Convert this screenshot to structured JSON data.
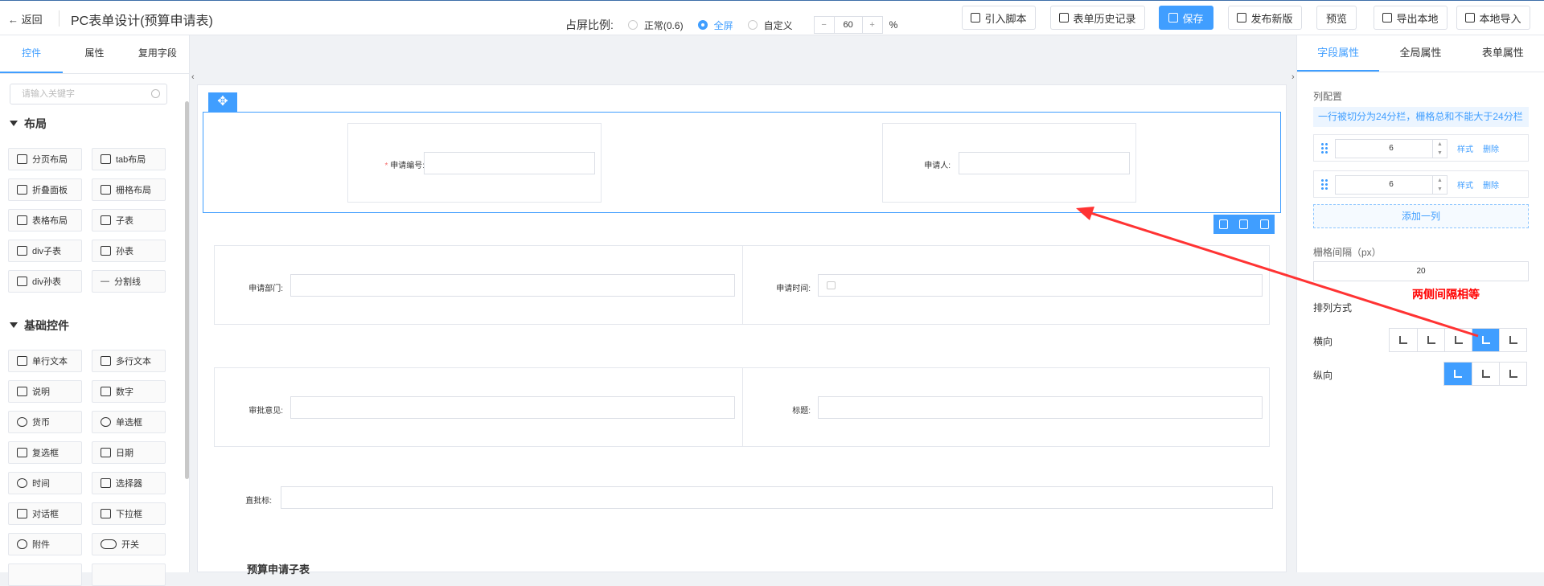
{
  "topbar": {
    "back": "返回",
    "title": "PC表单设计(预算申请表)",
    "buttons": [
      {
        "label": "引入脚本",
        "icon": "script-icon"
      },
      {
        "label": "表单历史记录",
        "icon": "history-icon"
      },
      {
        "label": "保存",
        "icon": "save-icon"
      },
      {
        "label": "发布新版",
        "icon": "send-icon"
      },
      {
        "label": "预览",
        "icon": ""
      },
      {
        "label": "导出本地",
        "icon": "folder-icon"
      },
      {
        "label": "本地导入",
        "icon": "folder-icon"
      }
    ]
  },
  "left": {
    "tabs": [
      "控件",
      "属性",
      "复用字段"
    ],
    "search_placeholder": "请输入关键字",
    "layout_title": "布局",
    "layout_items": [
      "分页布局",
      "tab布局",
      "折叠面板",
      "栅格布局",
      "表格布局",
      "子表",
      "div子表",
      "孙表",
      "div孙表",
      "分割线"
    ],
    "basic_title": "基础控件",
    "basic_items": [
      "单行文本",
      "多行文本",
      "说明",
      "数字",
      "货币",
      "单选框",
      "复选框",
      "日期",
      "时间",
      "选择器",
      "对话框",
      "下拉框",
      "附件",
      "开关"
    ]
  },
  "canvas": {
    "ratio_label": "占屏比例:",
    "options": [
      "正常(0.6)",
      "全屏",
      "自定义"
    ],
    "selected": "全屏",
    "minus": "−",
    "plus": "+",
    "value": "60",
    "unit": "%"
  },
  "form": {
    "apply_no": "申请编号:",
    "applicant": "申请人:",
    "dept": "申请部门:",
    "time": "申请时间:",
    "opinion": "审批意见:",
    "title_lbl": "标题:",
    "stamp": "直批标:",
    "sub_title": "预算申请子表"
  },
  "right": {
    "tabs": [
      "字段属性",
      "全局属性",
      "表单属性"
    ],
    "col_config": "列配置",
    "note": "一行被切分为24分栏，栅格总和不能大于24分栏",
    "cols": [
      {
        "value": "6",
        "style": "样式",
        "del": "删除"
      },
      {
        "value": "6",
        "style": "样式",
        "del": "删除"
      }
    ],
    "add_col": "添加一列",
    "gap_label": "栅格间隔（px）",
    "gap_value": "20",
    "arrange": "排列方式",
    "horizontal": "横向",
    "vertical": "纵向"
  },
  "annotation": "两侧间隔相等",
  "colors": {
    "accent": "#409eff",
    "annotation": "#ff0000"
  }
}
